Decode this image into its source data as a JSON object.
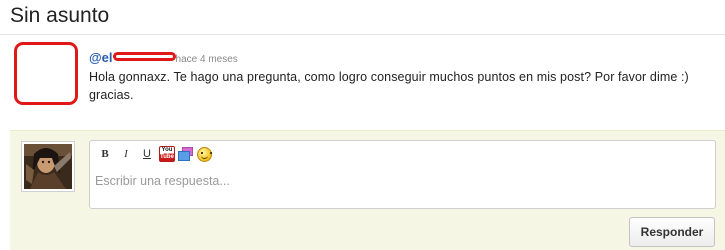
{
  "page": {
    "title": "Sin asunto"
  },
  "message": {
    "author_visible": "@el",
    "time": "hace 4 meses",
    "body": "Hola gonnaxz. Te hago una pregunta, como logro conseguir muchos puntos en mis post? Por favor dime :) gracias.",
    "redaction_color": "#e01818"
  },
  "reply": {
    "toolbar": {
      "bold_label": "B",
      "italic_label": "I",
      "underline_label": "U",
      "youtube_icon_top": "You",
      "youtube_icon_bottom": "Tube",
      "image_icon": "image-icon",
      "emoticon_icon": "smiley-icon"
    },
    "placeholder": "Escribir una respuesta...",
    "submit_label": "Responder",
    "background_color": "#f6f6e4"
  }
}
